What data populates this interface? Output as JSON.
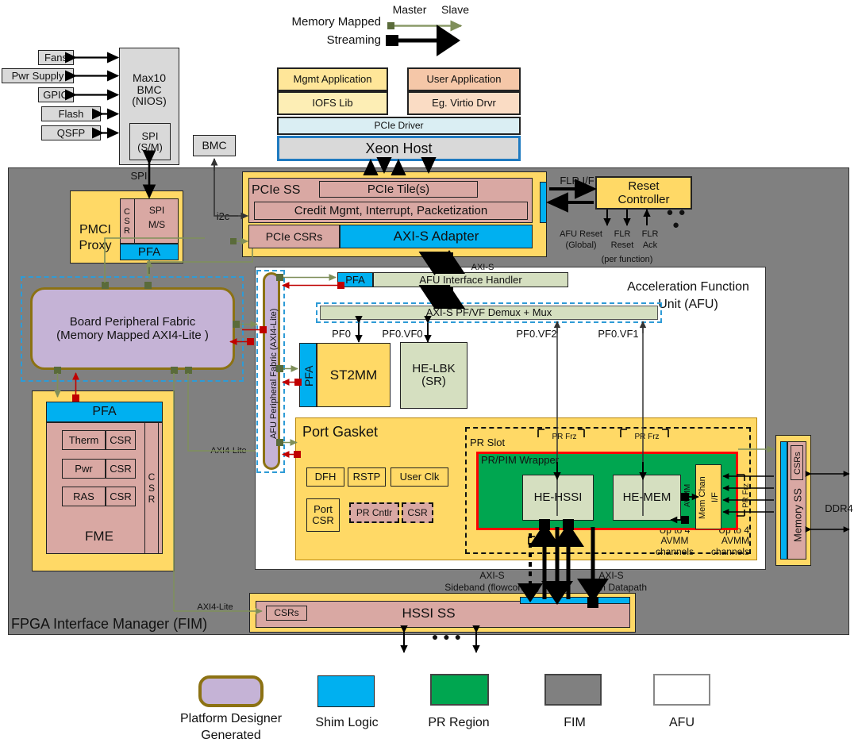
{
  "legend_top": {
    "memory_mapped_label": "Memory Mapped",
    "streaming_label": "Streaming",
    "master_label": "Master",
    "slave_label": "Slave",
    "mm_color": "#7f8f5a",
    "stream_color": "#000000"
  },
  "host_stack": {
    "mgmt_application": "Mgmt Application",
    "iofs_lib": "IOFS Lib",
    "user_application": "User Application",
    "virtio_drvr": "Eg. Virtio Drvr",
    "pcie_driver": "PCIe Driver",
    "xeon_host": "Xeon Host"
  },
  "board": {
    "fans": "Fans",
    "pwr_supply": "Pwr Supply",
    "gpio": "GPIO",
    "flash": "Flash",
    "qsfp": "QSFP",
    "max10_bmc": "Max10\nBMC\n(NIOS)",
    "max10_line1": "Max10",
    "max10_line2": "BMC",
    "max10_line3": "(NIOS)",
    "spi_sm": "SPI\n(S/M)",
    "spi_sm_l1": "SPI",
    "spi_sm_l2": "(S/M)",
    "bmc": "BMC",
    "spi_label": "SPI",
    "i2c_label": "i2c"
  },
  "pmci": {
    "title_l1": "PMCI",
    "title_l2": "Proxy",
    "csr": "C\nS\nR",
    "csr_c": "C",
    "csr_s": "S",
    "csr_r": "R",
    "spi_ms": "SPI\nM/S",
    "spi_ms_l1": "SPI",
    "spi_ms_l2": "M/S",
    "pfa": "PFA"
  },
  "pcie_ss": {
    "title": "PCIe SS",
    "tiles": "PCIe Tile(s)",
    "credit": "Credit Mgmt, Interrupt, Packetization",
    "csrs": "PCIe CSRs",
    "axis_adapter": "AXI-S Adapter"
  },
  "reset_controller": {
    "title_l1": "Reset",
    "title_l2": "Controller",
    "flr_if": "FLR I/F",
    "afu_reset_l1": "AFU Reset",
    "afu_reset_l2": "(Global)",
    "flr_reset_l1": "FLR",
    "flr_reset_l2": "Reset",
    "flr_ack_l1": "FLR",
    "flr_ack_l2": "Ack",
    "per_function": "(per function)",
    "ellipsis": "● ● ●"
  },
  "bpf": {
    "line1": "Board Peripheral Fabric",
    "line2": "(Memory Mapped AXI4-Lite )"
  },
  "afu_fabric": {
    "label": "AFU Peripheral Fabric (AXI4-Lite)"
  },
  "fme": {
    "pfa": "PFA",
    "therm": "Therm",
    "pwr": "Pwr",
    "ras": "RAS",
    "csr": "CSR",
    "csr_vertical_c": "C",
    "csr_vertical_s": "S",
    "csr_vertical_r": "R",
    "title": "FME"
  },
  "afu": {
    "title_l1": "Acceleration Function",
    "title_l2": "Unit (AFU)",
    "pfa": "PFA",
    "interface_handler": "AFU Interface Handler",
    "demux": "AXI-S PF/VF Demux + Mux",
    "axis_label": "AXI-S",
    "st2mm": "ST2MM",
    "st2mm_pfa": "PFA",
    "he_lbk_l1": "HE-LBK",
    "he_lbk_l2": "(SR)",
    "pf0": "PF0",
    "pf0vf0": "PF0.VF0",
    "pf0vf2": "PF0.VF2",
    "pf0vf1": "PF0.VF1"
  },
  "port_gasket": {
    "title": "Port Gasket",
    "dfh": "DFH",
    "rstp": "RSTP",
    "user_clk": "User Clk",
    "port_csr_l1": "Port",
    "port_csr_l2": "CSR",
    "pr_cntlr": "PR Cntlr",
    "csr": "CSR",
    "pr_slot": "PR Slot",
    "pr_pim_wrapper": "PR/PIM Wrapper",
    "he_hssi": "HE-HSSI",
    "he_mem": "HE-MEM",
    "avmm": "AVMM",
    "mem_chan_l1": "Mem Chan",
    "mem_chan_l2": "I/F",
    "pr_frz": "PR Frz",
    "avmm_channels": "Up to 4 AVMM channels"
  },
  "memory_ss": {
    "csrs": "CSRs",
    "title": "Memory SS",
    "ddr4": "DDR4"
  },
  "hssi_ss": {
    "csrs": "CSRs",
    "title": "HSSI SS",
    "axis_sideband_l1": "AXI-S",
    "axis_sideband_l2": "Sideband (flowcontrol)",
    "axis_eth_l1": "AXI-S",
    "axis_eth_l2": "Eth Datapath",
    "ellipsis": "● ● ●"
  },
  "fim": {
    "title": "FPGA Interface Manager (FIM)",
    "axi4lite_left": "AXI4-Lite",
    "axi4lite_bottom": "AXI4-Lite"
  },
  "legend_bottom": {
    "items": [
      {
        "label_l1": "Platform Designer",
        "label_l2": "Generated",
        "color": "#c5b3d6",
        "shape": "rounded",
        "border": "#8c7213"
      },
      {
        "label_l1": "Shim Logic",
        "label_l2": "",
        "color": "#00b0f0",
        "shape": "rect",
        "border": "#222222"
      },
      {
        "label_l1": "PR Region",
        "label_l2": "",
        "color": "#00a650",
        "shape": "rect",
        "border": "#444444"
      },
      {
        "label_l1": "FIM",
        "label_l2": "",
        "color": "#808080",
        "shape": "rect",
        "border": "#444444"
      },
      {
        "label_l1": "AFU",
        "label_l2": "",
        "color": "#ffffff",
        "shape": "rect",
        "border": "#888888"
      }
    ]
  }
}
